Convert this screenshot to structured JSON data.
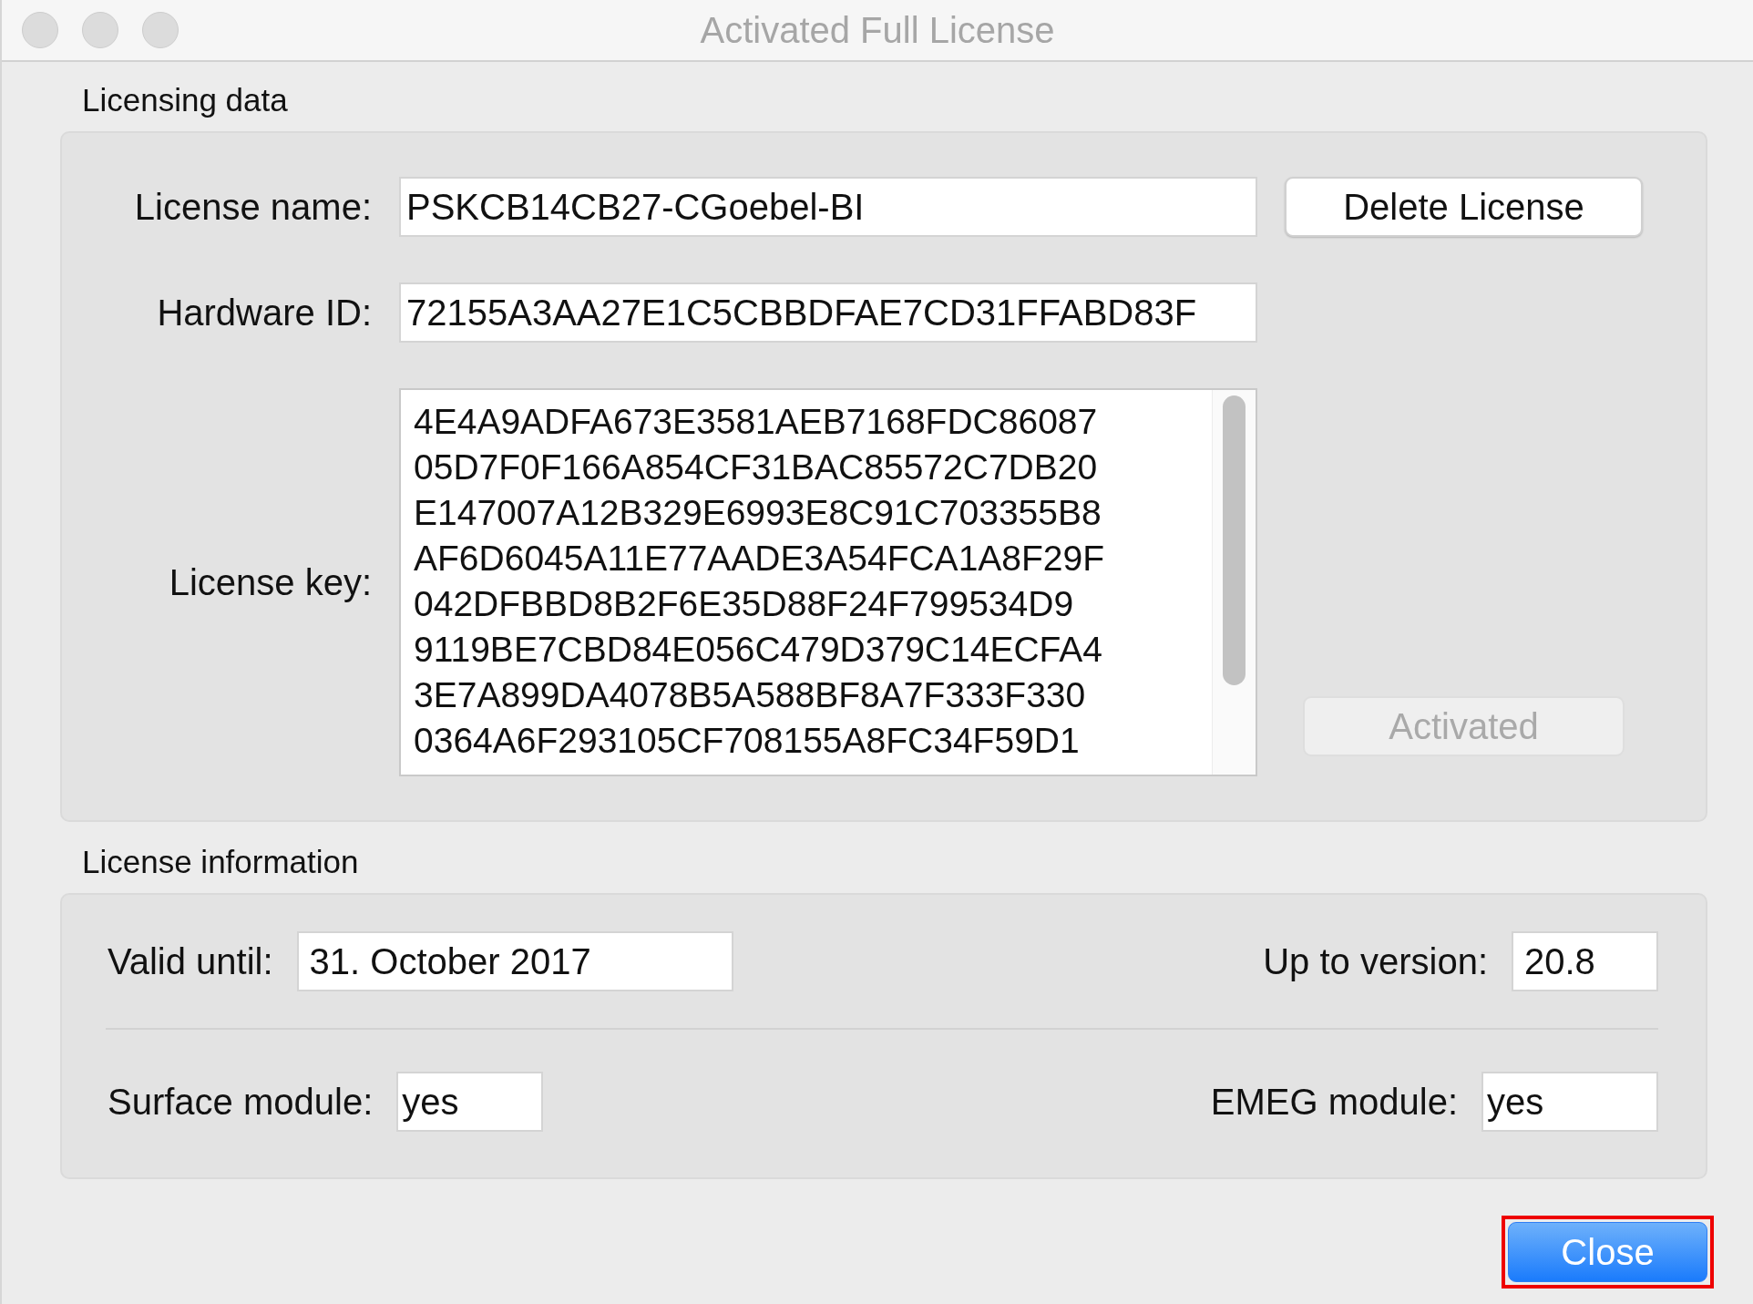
{
  "window": {
    "title": "Activated Full License"
  },
  "licensing_data": {
    "heading": "Licensing data",
    "fields": [
      {
        "label": "License name:",
        "value": "PSKCB14CB27-CGoebel-BI"
      },
      {
        "label": "Hardware ID:",
        "value": "72155A3AA27E1C5CBBDFAE7CD31FFABD83F"
      }
    ],
    "license_key": {
      "label": "License key:",
      "lines": [
        "4E4A9ADFA673E3581AEB7168FDC86087",
        "05D7F0F166A854CF31BAC85572C7DB20",
        "E147007A12B329E6993E8C91C703355B8",
        "AF6D6045A11E77AADE3A54FCA1A8F29F",
        "042DFBBD8B2F6E35D88F24F799534D9",
        "9119BE7CBD84E056C479D379C14ECFA4",
        "3E7A899DA4078B5A588BF8A7F333F330",
        "0364A6F293105CF708155A8FC34F59D1"
      ]
    },
    "buttons": [
      {
        "label": "Delete License",
        "disabled": false
      },
      {
        "label": "Activated",
        "disabled": true
      }
    ]
  },
  "license_information": {
    "heading": "License information",
    "rows": [
      [
        {
          "label": "Valid until:",
          "value": "31. October 2017"
        },
        {
          "label": "Up to version:",
          "value": "20.8"
        }
      ],
      [
        {
          "label": "Surface module:",
          "value": "yes"
        },
        {
          "label": "EMEG module:",
          "value": "yes"
        }
      ]
    ]
  },
  "close_button": {
    "label": "Close",
    "highlighted": true
  }
}
